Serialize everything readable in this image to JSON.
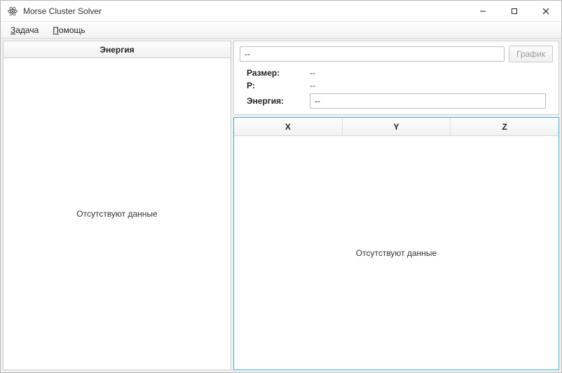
{
  "window": {
    "title": "Morse Cluster Solver"
  },
  "menu": {
    "task": "Задача",
    "help": "Помощь"
  },
  "left": {
    "header": "Энергия",
    "empty": "Отсутствуют данные"
  },
  "top": {
    "name_value": "--",
    "graph_button": "График",
    "size_label": "Размер:",
    "size_value": "--",
    "p_label": "P:",
    "p_value": "--",
    "energy_label": "Энергия:",
    "energy_value": "--"
  },
  "grid": {
    "cols": {
      "x": "X",
      "y": "Y",
      "z": "Z"
    },
    "empty": "Отсутствуют данные"
  }
}
